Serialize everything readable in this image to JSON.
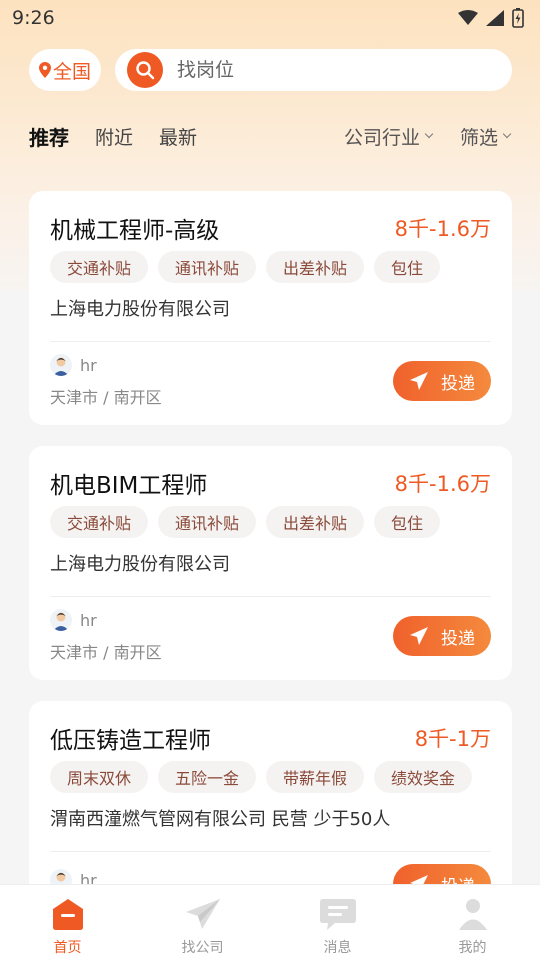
{
  "status_bar": {
    "time": "9:26"
  },
  "header": {
    "region_label": "全国",
    "search_placeholder": "找岗位"
  },
  "tabs": [
    {
      "label": "推荐",
      "active": true
    },
    {
      "label": "附近",
      "active": false
    },
    {
      "label": "最新",
      "active": false
    }
  ],
  "filters": [
    {
      "label": "公司行业"
    },
    {
      "label": "筛选"
    }
  ],
  "jobs": [
    {
      "title": "机械工程师-高级",
      "salary": "8千-1.6万",
      "tags": [
        "交通补贴",
        "通讯补贴",
        "出差补贴",
        "包住"
      ],
      "company": "上海电力股份有限公司",
      "hr": "hr",
      "location": "天津市 / 南开区",
      "apply_label": "投递"
    },
    {
      "title": "机电BIM工程师",
      "salary": "8千-1.6万",
      "tags": [
        "交通补贴",
        "通讯补贴",
        "出差补贴",
        "包住"
      ],
      "company": "上海电力股份有限公司",
      "hr": "hr",
      "location": "天津市 / 南开区",
      "apply_label": "投递"
    },
    {
      "title": "低压铸造工程师",
      "salary": "8千-1万",
      "tags": [
        "周末双休",
        "五险一金",
        "带薪年假",
        "绩效奖金"
      ],
      "company": "渭南西潼燃气管网有限公司 民营 少于50人",
      "hr": "hr",
      "location": "",
      "apply_label": "投递"
    }
  ],
  "bottom_nav": [
    {
      "label": "首页",
      "active": true,
      "icon": "home-icon"
    },
    {
      "label": "找公司",
      "active": false,
      "icon": "paper-plane-icon"
    },
    {
      "label": "消息",
      "active": false,
      "icon": "message-icon"
    },
    {
      "label": "我的",
      "active": false,
      "icon": "user-icon"
    }
  ],
  "colors": {
    "accent": "#ef5a24",
    "background": "#f5f5f5"
  }
}
